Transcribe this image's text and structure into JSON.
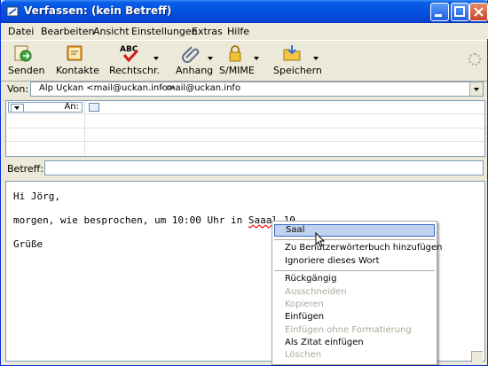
{
  "window": {
    "title": "Verfassen: (kein Betreff)",
    "accent": "#0a5fe8"
  },
  "menu": [
    {
      "label": "Datei"
    },
    {
      "label": "Bearbeiten"
    },
    {
      "label": "Ansicht"
    },
    {
      "label": "Einstellungen"
    },
    {
      "label": "Extras"
    },
    {
      "label": "Hilfe"
    }
  ],
  "toolbar": {
    "send": {
      "label": "Senden",
      "icon": "send-icon"
    },
    "contacts": {
      "label": "Kontakte",
      "icon": "address-book-icon"
    },
    "spell": {
      "label": "Rechtschr.",
      "icon": "spellcheck-icon",
      "abc": "ABC"
    },
    "attach": {
      "label": "Anhang",
      "icon": "paperclip-icon"
    },
    "smime": {
      "label": "S/MIME",
      "icon": "lock-icon"
    },
    "save": {
      "label": "Speichern",
      "icon": "save-folder-icon"
    }
  },
  "from": {
    "label": "Von:",
    "value": "Alp Uçkan <mail@uckan.info>",
    "account": "- mail@uckan.info"
  },
  "recipients": {
    "type": "An:"
  },
  "subject": {
    "label": "Betreff:",
    "value": ""
  },
  "body": {
    "line1": "Hi Jörg,",
    "line2_before": "morgen, wie besprochen, um 10:00 Uhr in ",
    "line2_word": "Saaal",
    "line2_after": " 10",
    "line3": "Grüße"
  },
  "context_menu": {
    "suggestion": "Saal",
    "add_to_dictionary": "Zu Benutzerwörterbuch hinzufügen",
    "ignore_word": "Ignoriere dieses Wort",
    "undo": "Rückgängig",
    "cut": "Ausschneiden",
    "copy": "Kopieren",
    "paste": "Einfügen",
    "paste_plain": "Einfügen ohne Formatierung",
    "paste_quote": "Als Zitat einfügen",
    "delete": "Löschen"
  }
}
